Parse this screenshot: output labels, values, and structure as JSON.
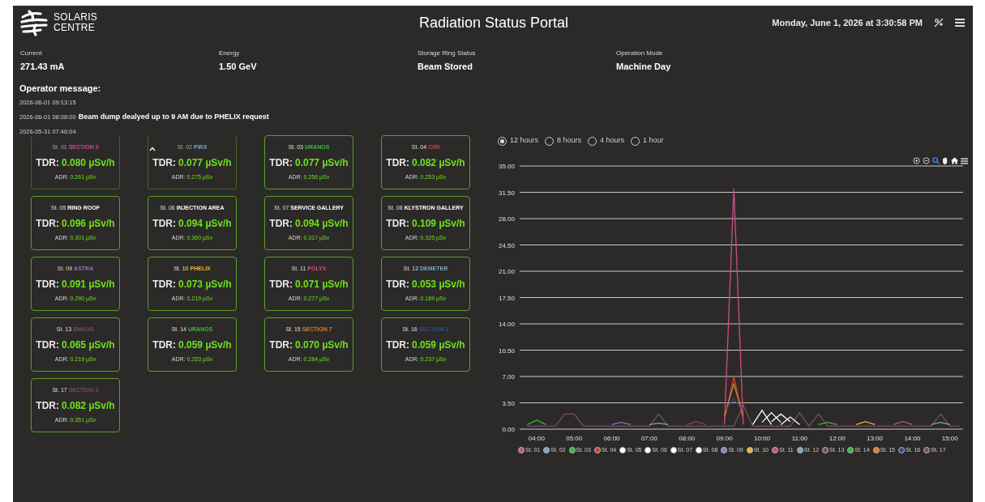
{
  "header": {
    "logo_lines": [
      "SOLARIS",
      "CENTRE"
    ],
    "title": "Radiation Status Portal",
    "datetime": "Monday, June 1, 2026 at 3:30:58 PM"
  },
  "stats": [
    {
      "label": "Current",
      "value": "271.43 mA"
    },
    {
      "label": "Energy",
      "value": "1.50 GeV"
    },
    {
      "label": "Storage Ring Status",
      "value": "Beam Stored"
    },
    {
      "label": "Operation Mode",
      "value": "Machine Day"
    }
  ],
  "operator_message": {
    "heading": "Operator message:",
    "messages": [
      {
        "time": "2026-06-01 09:13:15"
      },
      {
        "time": "2026-06-01 08:08:00",
        "text": "Beam dump dealyed up to 9 AM due to PHELIX request"
      },
      {
        "time": "2026-05-31 07:46:04"
      }
    ]
  },
  "stations": [
    {
      "number": "St. 01",
      "name": "SECTION 9",
      "color": "#c0508a",
      "faded": true,
      "tdr_label": "TDR:",
      "tdr": "0.080 µSv/h",
      "adr_label": "ADR:",
      "adr": "0.261 µSv"
    },
    {
      "number": "St. 02",
      "name": "PIRX",
      "color": "#7aa6c2",
      "faded": true,
      "tdr_label": "TDR:",
      "tdr": "0.077 µSv/h",
      "adr_label": "ADR:",
      "adr": "0.275 µSv"
    },
    {
      "number": "St. 03",
      "name": "URANOS",
      "color": "#3cb83c",
      "faded": false,
      "tdr_label": "TDR:",
      "tdr": "0.077 µSv/h",
      "adr_label": "ADR:",
      "adr": "0.256 µSv"
    },
    {
      "number": "St. 04",
      "name": "CIRI",
      "color": "#d0402f",
      "faded": false,
      "tdr_label": "TDR:",
      "tdr": "0.082 µSv/h",
      "adr_label": "ADR:",
      "adr": "0.253 µSv"
    },
    {
      "number": "St. 05",
      "name": "RING ROOF",
      "color": "#ffffff",
      "faded": false,
      "tdr_label": "TDR:",
      "tdr": "0.096 µSv/h",
      "adr_label": "ADR:",
      "adr": "0.301 µSv"
    },
    {
      "number": "St. 06",
      "name": "INJECTION AREA",
      "color": "#ffffff",
      "faded": false,
      "tdr_label": "TDR:",
      "tdr": "0.094 µSv/h",
      "adr_label": "ADR:",
      "adr": "0.360 µSv"
    },
    {
      "number": "St. 07",
      "name": "SERVICE GALLERY",
      "color": "#ffffff",
      "faded": false,
      "tdr_label": "TDR:",
      "tdr": "0.094 µSv/h",
      "adr_label": "ADR:",
      "adr": "0.317 µSv"
    },
    {
      "number": "St. 08",
      "name": "KLYSTRON GALLERY",
      "color": "#ffffff",
      "faded": false,
      "tdr_label": "TDR:",
      "tdr": "0.109 µSv/h",
      "adr_label": "ADR:",
      "adr": "0.325 µSv"
    },
    {
      "number": "St. 09",
      "name": "ASTRA",
      "color": "#8a7bbf",
      "faded": false,
      "tdr_label": "TDR:",
      "tdr": "0.091 µSv/h",
      "adr_label": "ADR:",
      "adr": "0.290 µSv"
    },
    {
      "number": "St. 10",
      "name": "PHELIX",
      "color": "#f0b429",
      "faded": false,
      "tdr_label": "TDR:",
      "tdr": "0.073 µSv/h",
      "adr_label": "ADR:",
      "adr": "0.219 µSv"
    },
    {
      "number": "St. 11",
      "name": "POLYX",
      "color": "#d04a8a",
      "faded": false,
      "tdr_label": "TDR:",
      "tdr": "0.071 µSv/h",
      "adr_label": "ADR:",
      "adr": "0.277 µSv"
    },
    {
      "number": "St. 12",
      "name": "DEMETER",
      "color": "#7aa6c2",
      "faded": false,
      "tdr_label": "TDR:",
      "tdr": "0.053 µSv/h",
      "adr_label": "ADR:",
      "adr": "0.189 µSv"
    },
    {
      "number": "St. 13",
      "name": "SMAUG",
      "color": "#7a4a70",
      "faded": false,
      "tdr_label": "TDR:",
      "tdr": "0.065 µSv/h",
      "adr_label": "ADR:",
      "adr": "0.219 µSv"
    },
    {
      "number": "St. 14",
      "name": "URANOS",
      "color": "#3cb83c",
      "faded": false,
      "tdr_label": "TDR:",
      "tdr": "0.059 µSv/h",
      "adr_label": "ADR:",
      "adr": "0.253 µSv"
    },
    {
      "number": "St. 15",
      "name": "SECTION 7",
      "color": "#e07b28",
      "faded": false,
      "tdr_label": "TDR:",
      "tdr": "0.070 µSv/h",
      "adr_label": "ADR:",
      "adr": "0.284 µSv"
    },
    {
      "number": "St. 16",
      "name": "SECTION 3",
      "color": "#2a4f8a",
      "faded": false,
      "tdr_label": "TDR:",
      "tdr": "0.059 µSv/h",
      "adr_label": "ADR:",
      "adr": "0.237 µSv"
    },
    {
      "number": "St. 17",
      "name": "SECTION 2",
      "color": "#7a4a70",
      "faded": false,
      "tdr_label": "TDR:",
      "tdr": "0.082 µSv/h",
      "adr_label": "ADR:",
      "adr": "0.351 µSv"
    }
  ],
  "range_options": [
    {
      "label": "12 hours",
      "selected": true
    },
    {
      "label": "8 hours",
      "selected": false
    },
    {
      "label": "4 hours",
      "selected": false
    },
    {
      "label": "1 hour",
      "selected": false
    }
  ],
  "chart": {
    "chart_data": {
      "type": "line",
      "grid": true,
      "legend": true,
      "x": [
        3.75,
        4,
        4.25,
        4.5,
        4.75,
        5,
        5.25,
        5.5,
        5.75,
        6,
        6.25,
        6.5,
        6.75,
        7,
        7.25,
        7.5,
        7.75,
        8,
        8.25,
        8.5,
        8.75,
        9,
        9.25,
        9.5,
        9.75,
        10,
        10.25,
        10.5,
        10.75,
        11,
        11.25,
        11.5,
        11.75,
        12,
        12.25,
        12.5,
        12.75,
        13,
        13.25,
        13.5,
        13.75,
        14,
        14.25,
        14.5,
        14.75,
        15,
        15.25
      ],
      "xlim": [
        3.55,
        15.35
      ],
      "ylim": [
        0,
        35
      ],
      "xticks": [
        {
          "value": 4,
          "label": "04:00"
        },
        {
          "value": 5,
          "label": "05:00"
        },
        {
          "value": 6,
          "label": "06:00"
        },
        {
          "value": 7,
          "label": "07:00"
        },
        {
          "value": 8,
          "label": "08:00"
        },
        {
          "value": 9,
          "label": "09:00"
        },
        {
          "value": 10,
          "label": "10:00"
        },
        {
          "value": 11,
          "label": "11:00"
        },
        {
          "value": 12,
          "label": "12:00"
        },
        {
          "value": 13,
          "label": "13:00"
        },
        {
          "value": 14,
          "label": "14:00"
        },
        {
          "value": 15,
          "label": "15:00"
        }
      ],
      "yticks": [
        {
          "value": 0,
          "label": "0.00"
        },
        {
          "value": 3.5,
          "label": "3.50"
        },
        {
          "value": 7,
          "label": "7.00"
        },
        {
          "value": 10.5,
          "label": "10.50"
        },
        {
          "value": 14,
          "label": "14.00"
        },
        {
          "value": 17.5,
          "label": "17.50"
        },
        {
          "value": 21,
          "label": "21.00"
        },
        {
          "value": 24.5,
          "label": "24.50"
        },
        {
          "value": 28,
          "label": "28.00"
        },
        {
          "value": 31.5,
          "label": "31.50"
        },
        {
          "value": 35,
          "label": "35.00"
        }
      ],
      "series": [
        {
          "name": "St. 01",
          "color": "#c0508a",
          "values": [
            null,
            null,
            null,
            null,
            null,
            null,
            null,
            null,
            null,
            null,
            null,
            null,
            null,
            null,
            null,
            null,
            null,
            null,
            null,
            null,
            null,
            null,
            null,
            null,
            null,
            null,
            null,
            null,
            null,
            null,
            null,
            null,
            null,
            null,
            null,
            null,
            null,
            null,
            null,
            0.6,
            1.0,
            0.6,
            null,
            null,
            null,
            null,
            null
          ]
        },
        {
          "name": "St. 02",
          "color": "#7aa6c2",
          "values": [
            null,
            null,
            null,
            null,
            null,
            null,
            null,
            null,
            null,
            null,
            null,
            null,
            null,
            null,
            null,
            null,
            null,
            null,
            null,
            null,
            null,
            null,
            null,
            null,
            null,
            null,
            null,
            null,
            null,
            null,
            null,
            null,
            null,
            null,
            null,
            null,
            null,
            null,
            null,
            null,
            null,
            null,
            null,
            0.6,
            0.9,
            0.6,
            null
          ]
        },
        {
          "name": "St. 03",
          "color": "#3cb83c",
          "values": [
            0.6,
            1.2,
            0.6,
            null,
            null,
            null,
            null,
            null,
            null,
            null,
            null,
            null,
            null,
            null,
            null,
            null,
            null,
            null,
            null,
            null,
            null,
            null,
            null,
            null,
            null,
            null,
            null,
            null,
            null,
            null,
            null,
            null,
            null,
            null,
            null,
            null,
            null,
            null,
            null,
            null,
            null,
            null,
            null,
            null,
            null,
            null,
            null
          ]
        },
        {
          "name": "St. 04",
          "color": "#d0402f",
          "values": [
            null,
            null,
            null,
            null,
            null,
            null,
            null,
            null,
            null,
            null,
            null,
            null,
            null,
            null,
            null,
            null,
            null,
            null,
            null,
            null,
            null,
            1.2,
            7.0,
            1.2,
            null,
            null,
            null,
            null,
            null,
            null,
            null,
            null,
            null,
            null,
            null,
            null,
            null,
            null,
            null,
            null,
            null,
            null,
            null,
            null,
            null,
            null,
            null
          ]
        },
        {
          "name": "St. 05",
          "color": "#ffffff",
          "values": [
            null,
            null,
            null,
            null,
            null,
            null,
            null,
            null,
            null,
            null,
            null,
            null,
            null,
            null,
            null,
            null,
            null,
            null,
            null,
            null,
            null,
            null,
            null,
            null,
            0.6,
            2.5,
            0.6,
            null,
            null,
            null,
            null,
            null,
            null,
            null,
            null,
            null,
            null,
            null,
            null,
            null,
            null,
            null,
            null,
            null,
            null,
            null,
            null
          ]
        },
        {
          "name": "St. 06",
          "color": "#ffffff",
          "values": [
            null,
            null,
            null,
            null,
            null,
            null,
            null,
            null,
            null,
            null,
            null,
            null,
            null,
            null,
            null,
            null,
            null,
            null,
            null,
            null,
            null,
            null,
            null,
            null,
            null,
            0.9,
            2.2,
            0.9,
            null,
            null,
            null,
            null,
            null,
            null,
            null,
            null,
            null,
            null,
            null,
            null,
            null,
            null,
            null,
            null,
            null,
            null,
            null
          ]
        },
        {
          "name": "St. 07",
          "color": "#ffffff",
          "values": [
            null,
            null,
            null,
            null,
            null,
            null,
            null,
            null,
            null,
            null,
            null,
            null,
            null,
            null,
            null,
            null,
            null,
            null,
            null,
            null,
            null,
            null,
            null,
            null,
            null,
            null,
            1.0,
            2.0,
            1.0,
            null,
            null,
            null,
            null,
            null,
            null,
            null,
            null,
            null,
            null,
            null,
            null,
            null,
            null,
            null,
            null,
            null,
            null
          ]
        },
        {
          "name": "St. 08",
          "color": "#ffffff",
          "values": [
            null,
            null,
            null,
            null,
            null,
            null,
            null,
            null,
            null,
            null,
            null,
            null,
            null,
            null,
            null,
            null,
            null,
            null,
            null,
            null,
            null,
            null,
            null,
            null,
            null,
            null,
            null,
            0.6,
            1.6,
            0.6,
            null,
            null,
            null,
            null,
            null,
            null,
            null,
            null,
            null,
            null,
            null,
            null,
            null,
            null,
            null,
            null,
            null
          ]
        },
        {
          "name": "St. 09",
          "color": "#8a7bbf",
          "values": [
            null,
            null,
            null,
            null,
            null,
            null,
            null,
            null,
            null,
            0.6,
            0.9,
            0.6,
            null,
            null,
            null,
            null,
            null,
            null,
            null,
            null,
            null,
            null,
            null,
            null,
            null,
            null,
            null,
            null,
            null,
            null,
            null,
            null,
            null,
            null,
            null,
            null,
            null,
            null,
            null,
            null,
            null,
            null,
            null,
            null,
            null,
            null,
            null
          ]
        },
        {
          "name": "St. 10",
          "color": "#f0b429",
          "values": [
            null,
            null,
            null,
            null,
            null,
            null,
            null,
            null,
            null,
            null,
            null,
            null,
            null,
            null,
            null,
            null,
            null,
            null,
            null,
            null,
            null,
            null,
            null,
            null,
            null,
            null,
            null,
            null,
            null,
            null,
            null,
            null,
            null,
            null,
            null,
            0.6,
            1.0,
            0.6,
            null,
            null,
            null,
            null,
            null,
            null,
            null,
            null,
            null
          ]
        },
        {
          "name": "St. 11",
          "color": "#d04a8a",
          "values": [
            null,
            null,
            null,
            null,
            null,
            null,
            null,
            null,
            null,
            null,
            null,
            null,
            null,
            null,
            null,
            null,
            null,
            null,
            null,
            null,
            null,
            0.6,
            32.0,
            0.6,
            null,
            null,
            null,
            null,
            null,
            null,
            null,
            null,
            null,
            null,
            null,
            null,
            null,
            null,
            null,
            null,
            null,
            null,
            null,
            null,
            null,
            null,
            null
          ]
        },
        {
          "name": "St. 12",
          "color": "#7aa6c2",
          "values": [
            null,
            null,
            null,
            null,
            null,
            null,
            null,
            null,
            null,
            null,
            null,
            null,
            null,
            0.6,
            0.8,
            0.6,
            null,
            null,
            null,
            null,
            null,
            null,
            null,
            null,
            null,
            null,
            null,
            null,
            null,
            null,
            null,
            null,
            null,
            null,
            null,
            null,
            null,
            null,
            null,
            null,
            null,
            null,
            null,
            null,
            null,
            null,
            null
          ]
        },
        {
          "name": "St. 13",
          "color": "#7a4a70",
          "values": [
            null,
            null,
            null,
            null,
            null,
            null,
            null,
            null,
            null,
            null,
            null,
            null,
            null,
            null,
            null,
            null,
            null,
            0.6,
            1.0,
            0.6,
            null,
            null,
            null,
            null,
            null,
            null,
            null,
            null,
            null,
            null,
            null,
            null,
            null,
            null,
            null,
            null,
            null,
            null,
            null,
            null,
            null,
            null,
            null,
            null,
            null,
            null,
            null
          ]
        },
        {
          "name": "St. 14",
          "color": "#3cb83c",
          "values": [
            null,
            null,
            null,
            null,
            null,
            null,
            null,
            null,
            null,
            null,
            null,
            null,
            null,
            null,
            null,
            null,
            null,
            null,
            null,
            null,
            null,
            null,
            null,
            null,
            null,
            null,
            null,
            null,
            null,
            null,
            null,
            0.6,
            0.9,
            0.6,
            null,
            null,
            null,
            null,
            null,
            null,
            null,
            null,
            null,
            null,
            null,
            null,
            null
          ]
        },
        {
          "name": "St. 15",
          "color": "#e07b28",
          "values": [
            null,
            null,
            null,
            null,
            null,
            null,
            null,
            null,
            null,
            null,
            null,
            null,
            null,
            null,
            null,
            null,
            null,
            null,
            null,
            null,
            null,
            1.8,
            6.0,
            1.8,
            null,
            null,
            null,
            null,
            null,
            null,
            null,
            null,
            null,
            null,
            null,
            null,
            null,
            null,
            null,
            null,
            null,
            null,
            null,
            null,
            null,
            null,
            null
          ]
        },
        {
          "name": "St. 16",
          "color": "#2a4f8a",
          "values": [
            null,
            null,
            null,
            null,
            null,
            null,
            null,
            null,
            null,
            null,
            null,
            null,
            null,
            null,
            null,
            null,
            null,
            null,
            null,
            null,
            null,
            2.4,
            4.0,
            2.4,
            null,
            null,
            null,
            null,
            null,
            null,
            null,
            null,
            null,
            null,
            null,
            null,
            null,
            null,
            null,
            null,
            null,
            null,
            null,
            null,
            null,
            null,
            null
          ]
        },
        {
          "name": "St. 17",
          "color": "#7a4a70",
          "values": [
            0.4,
            0.4,
            0.4,
            0.4,
            2.0,
            2.0,
            0.4,
            0.4,
            0.4,
            0.4,
            0.4,
            0.4,
            0.4,
            0.4,
            2.0,
            0.4,
            0.4,
            0.4,
            0.4,
            0.4,
            0.4,
            0.4,
            0.4,
            3.2,
            0.4,
            0.4,
            0.4,
            0.4,
            0.4,
            2.2,
            0.4,
            2.0,
            0.4,
            0.4,
            0.4,
            0.4,
            0.4,
            0.4,
            0.4,
            0.4,
            0.4,
            0.4,
            0.4,
            0.4,
            2.0,
            0.4,
            0.4
          ]
        }
      ]
    }
  }
}
